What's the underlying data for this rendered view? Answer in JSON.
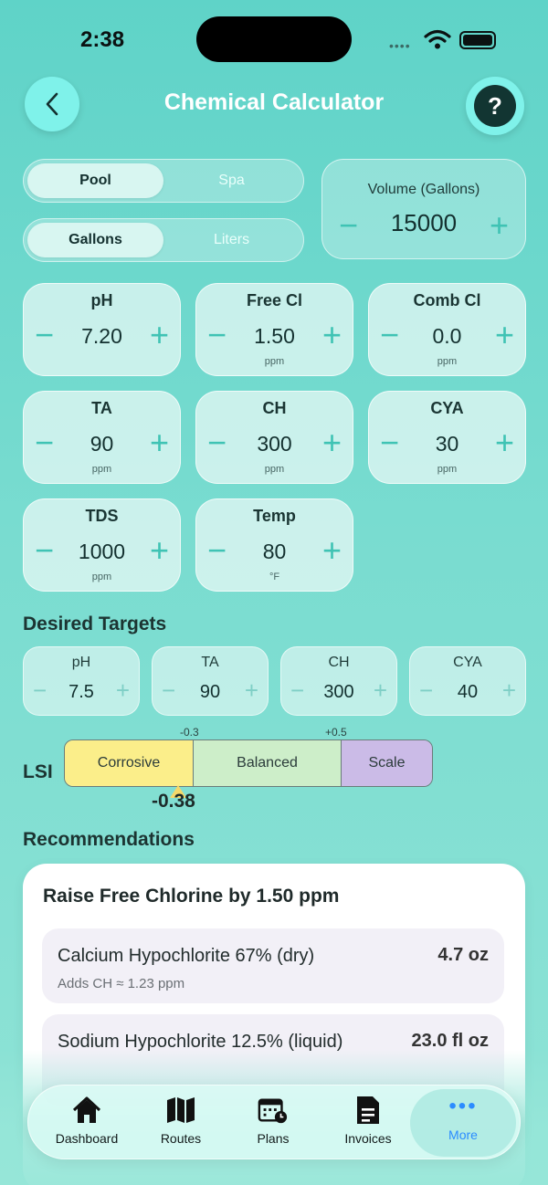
{
  "status": {
    "time": "2:38",
    "signal": "••••"
  },
  "header": {
    "title": "Chemical Calculator",
    "help_label": "?"
  },
  "water_type": {
    "options": [
      "Pool",
      "Spa"
    ],
    "selected": "Pool"
  },
  "units": {
    "options": [
      "Gallons",
      "Liters"
    ],
    "selected": "Gallons"
  },
  "volume": {
    "label": "Volume (Gallons)",
    "value": "15000",
    "minus": "−",
    "plus": "+"
  },
  "readings": [
    {
      "label": "pH",
      "value": "7.20",
      "unit": ""
    },
    {
      "label": "Free Cl",
      "value": "1.50",
      "unit": "ppm"
    },
    {
      "label": "Comb Cl",
      "value": "0.0",
      "unit": "ppm"
    },
    {
      "label": "TA",
      "value": "90",
      "unit": "ppm"
    },
    {
      "label": "CH",
      "value": "300",
      "unit": "ppm"
    },
    {
      "label": "CYA",
      "value": "30",
      "unit": "ppm"
    },
    {
      "label": "TDS",
      "value": "1000",
      "unit": "ppm"
    },
    {
      "label": "Temp",
      "value": "80",
      "unit": "°F"
    }
  ],
  "targets": {
    "title": "Desired Targets",
    "items": [
      {
        "label": "pH",
        "value": "7.5"
      },
      {
        "label": "TA",
        "value": "90"
      },
      {
        "label": "CH",
        "value": "300"
      },
      {
        "label": "CYA",
        "value": "40"
      }
    ]
  },
  "lsi": {
    "label": "LSI",
    "segments": [
      "Corrosive",
      "Balanced",
      "Scale"
    ],
    "colors": [
      "#fbee8a",
      "#cdeec9",
      "#cbbbe7"
    ],
    "tick_low": "-0.3",
    "tick_high": "+0.5",
    "value": "-0.38"
  },
  "recommendations": {
    "title": "Recommendations",
    "card_title": "Raise Free Chlorine by 1.50 ppm",
    "items": [
      {
        "name": "Calcium Hypochlorite 67% (dry)",
        "amount": "4.7 oz",
        "note": "Adds CH ≈ 1.23 ppm"
      },
      {
        "name": "Sodium Hypochlorite 12.5% (liquid)",
        "amount": "23.0 fl oz",
        "note": ""
      }
    ]
  },
  "tabs": [
    {
      "label": "Dashboard",
      "icon": "house-icon"
    },
    {
      "label": "Routes",
      "icon": "map-icon"
    },
    {
      "label": "Plans",
      "icon": "calendar-clock-icon"
    },
    {
      "label": "Invoices",
      "icon": "document-icon"
    },
    {
      "label": "More",
      "icon": "ellipsis-icon",
      "selected": true
    }
  ],
  "accent": "#3fc3b4",
  "tab_selected_color": "#2b8cff"
}
